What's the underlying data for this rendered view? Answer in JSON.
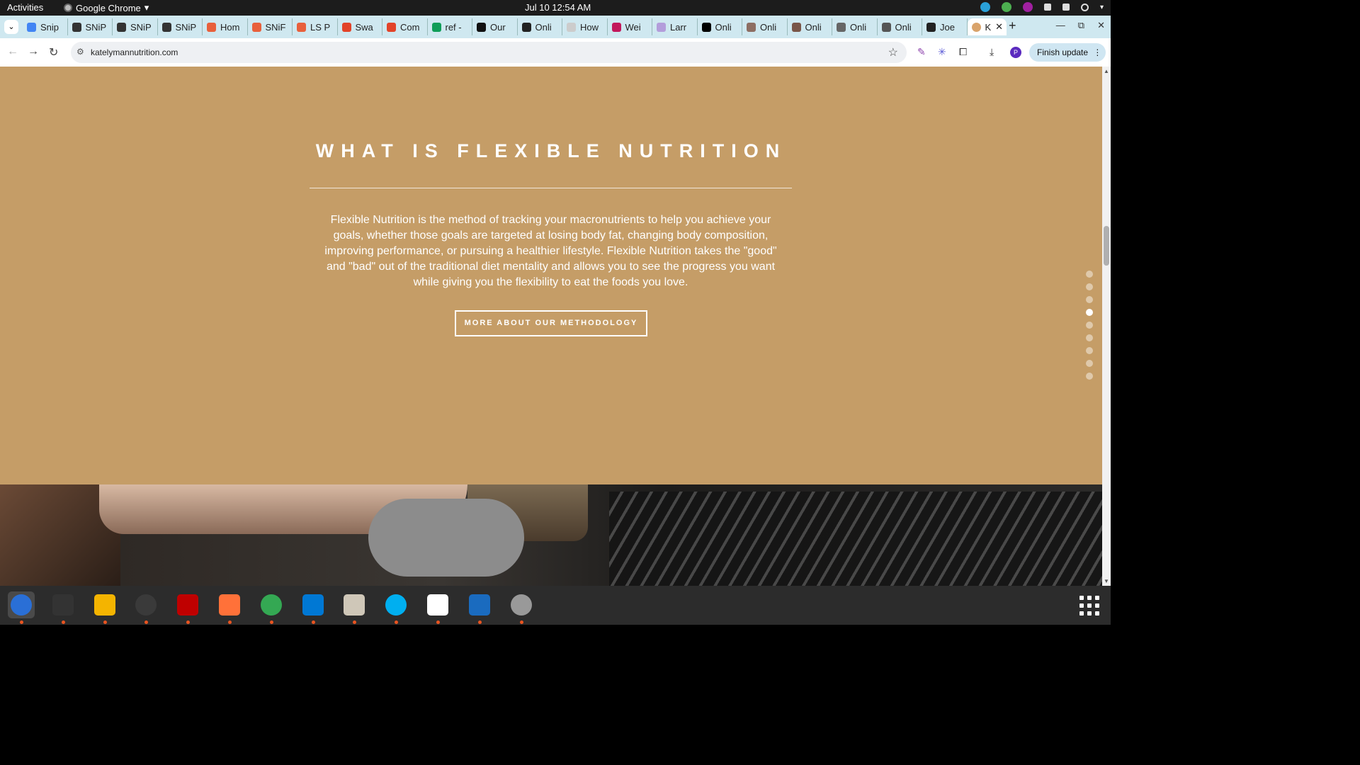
{
  "system": {
    "activities": "Activities",
    "app_name": "Google Chrome",
    "clock": "Jul 10  12:54 AM"
  },
  "browser": {
    "tabs": [
      {
        "label": "Snip",
        "color": "#4285f4"
      },
      {
        "label": "SNiP",
        "color": "#333333"
      },
      {
        "label": "SNiP",
        "color": "#333333"
      },
      {
        "label": "SNiP",
        "color": "#333333"
      },
      {
        "label": "Hom",
        "color": "#e8603c"
      },
      {
        "label": "SNiF",
        "color": "#e8603c"
      },
      {
        "label": "LS P",
        "color": "#e8603c"
      },
      {
        "label": "Swa",
        "color": "#e24329"
      },
      {
        "label": "Com",
        "color": "#e24329"
      },
      {
        "label": "ref -",
        "color": "#0f9d58"
      },
      {
        "label": "Our",
        "color": "#111111"
      },
      {
        "label": "Onli",
        "color": "#222222"
      },
      {
        "label": "How",
        "color": "#cccccc"
      },
      {
        "label": "Wei",
        "color": "#c2185b"
      },
      {
        "label": "Larr",
        "color": "#b39ddb"
      },
      {
        "label": "Onli",
        "color": "#000000"
      },
      {
        "label": "Onli",
        "color": "#8d6e63"
      },
      {
        "label": "Onli",
        "color": "#795548"
      },
      {
        "label": "Onli",
        "color": "#666666"
      },
      {
        "label": "Onli",
        "color": "#555555"
      },
      {
        "label": "Joe",
        "color": "#222222"
      }
    ],
    "active_tab": {
      "label": "K",
      "close": "✕"
    },
    "new_tab": "+",
    "url": "katelymannutrition.com",
    "finish_update": "Finish update",
    "profile_initial": "P"
  },
  "page": {
    "heading": "WHAT IS FLEXIBLE NUTRITION",
    "body": "Flexible Nutrition is the method of tracking your macronutrients to help you achieve your goals, whether those goals are targeted at losing body fat, changing body composition, improving performance, or pursuing a healthier lifestyle. Flexible Nutrition takes the \"good\" and \"bad\" out of the traditional diet mentality and allows you to see the progress you want while giving you the flexibility to eat the foods you love.",
    "cta": "MORE ABOUT OUR METHODOLOGY",
    "section_dots": 9,
    "active_dot_index": 3
  },
  "dock": {
    "apps": [
      {
        "name": "thunderbird",
        "color": "#2a6fd6"
      },
      {
        "name": "terminal",
        "color": "#333333"
      },
      {
        "name": "calculator",
        "color": "#f4b400"
      },
      {
        "name": "system-monitor",
        "color": "#3a3a3a"
      },
      {
        "name": "filezilla",
        "color": "#bf0000"
      },
      {
        "name": "firefox",
        "color": "#ff7139"
      },
      {
        "name": "chrome",
        "color": "#34a853"
      },
      {
        "name": "vscode",
        "color": "#0078d4"
      },
      {
        "name": "files",
        "color": "#cfc7b8"
      },
      {
        "name": "skype",
        "color": "#00aff0"
      },
      {
        "name": "text-editor",
        "color": "#ffffff"
      },
      {
        "name": "libreoffice-writer",
        "color": "#1a6bbf"
      },
      {
        "name": "disks",
        "color": "#999999"
      }
    ]
  }
}
